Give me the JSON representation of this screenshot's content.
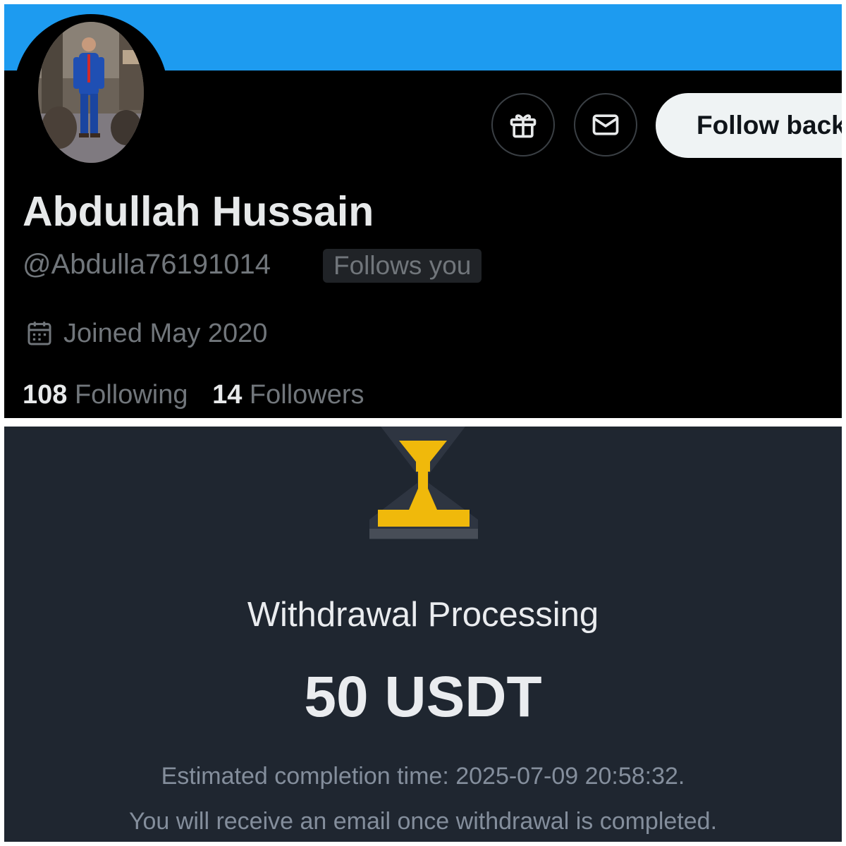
{
  "profile": {
    "display_name": "Abdullah Hussain",
    "handle": "@Abdulla76191014",
    "follows_badge": "Follows you",
    "joined": "Joined May 2020",
    "follow_button": "Follow back",
    "following_count": "108",
    "following_label": "Following",
    "followers_count": "14",
    "followers_label": "Followers",
    "icons": [
      "gift-icon",
      "envelope-icon",
      "calendar-icon"
    ],
    "colors": {
      "banner": "#1d9bf0",
      "background": "#000000"
    }
  },
  "withdrawal": {
    "title": "Withdrawal Processing",
    "amount": "50 USDT",
    "estimated_completion": "Estimated completion time: 2025-07-09 20:58:32.",
    "note": "You will receive an email once withdrawal is completed.",
    "icon": "hourglass-icon",
    "colors": {
      "background": "#1f2630",
      "accent": "#f0b90b"
    }
  }
}
